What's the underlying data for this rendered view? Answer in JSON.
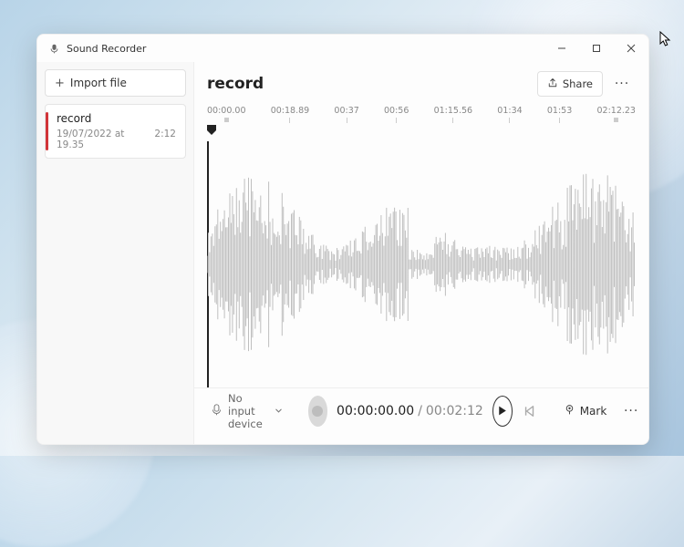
{
  "app": {
    "title": "Sound Recorder"
  },
  "sidebar": {
    "import_label": "Import file",
    "recordings": [
      {
        "name": "record",
        "date": "19/07/2022 at 19.35",
        "duration": "2:12"
      }
    ]
  },
  "main": {
    "title": "record",
    "share_label": "Share",
    "timeline_ticks": [
      "00:00.00",
      "00:18.89",
      "00:37",
      "00:56",
      "01:15.56",
      "01:34",
      "01:53",
      "02:12.23"
    ]
  },
  "footer": {
    "device_label": "No input device",
    "current_time": "00:00:00.00",
    "total_time": "00:02:12",
    "mark_label": "Mark"
  }
}
